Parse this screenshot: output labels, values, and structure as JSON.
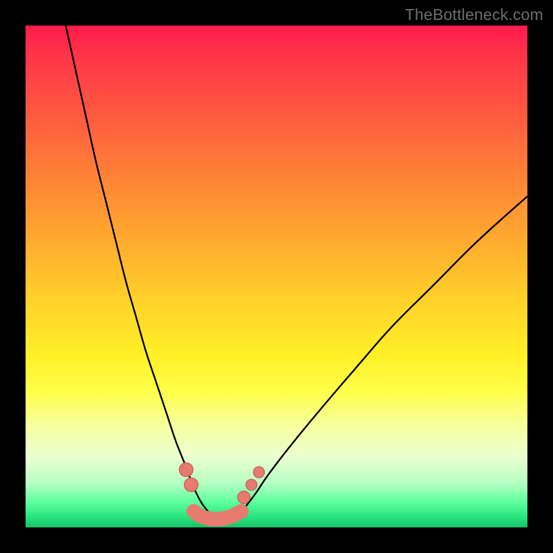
{
  "watermark": "TheBottleneck.com",
  "colors": {
    "background": "#000000",
    "gradient_top": "#ff1a4d",
    "gradient_bottom": "#19bf67",
    "curve": "#000000",
    "marker_fill": "#e77b70",
    "marker_stroke": "#c55a4f"
  },
  "chart_data": {
    "type": "line",
    "title": "",
    "xlabel": "",
    "ylabel": "",
    "xlim": [
      0,
      100
    ],
    "ylim": [
      0,
      100
    ],
    "grid": false,
    "legend": false,
    "series": [
      {
        "name": "left-curve",
        "x": [
          8,
          10,
          12,
          14,
          16,
          18,
          20,
          22,
          24,
          26,
          28,
          30,
          32,
          33.5,
          35,
          36.5
        ],
        "y": [
          100,
          91,
          82,
          73,
          65,
          57,
          49,
          42,
          35,
          29,
          23,
          17,
          12,
          8,
          5,
          3
        ]
      },
      {
        "name": "right-curve",
        "x": [
          43,
          44.5,
          46,
          48,
          51,
          55,
          60,
          66,
          73,
          81,
          90,
          100
        ],
        "y": [
          3,
          5,
          7,
          10,
          14,
          19,
          25,
          32,
          40,
          48,
          57,
          66
        ]
      },
      {
        "name": "trough-worm",
        "x": [
          33.5,
          35,
          37,
          39,
          41,
          43
        ],
        "y": [
          3.2,
          2.2,
          1.7,
          1.7,
          2.2,
          3.2
        ]
      }
    ],
    "markers": [
      {
        "name": "left-upper-dot",
        "x": 32.0,
        "y": 11.5,
        "r": 10
      },
      {
        "name": "left-lower-dot",
        "x": 33.0,
        "y": 8.5,
        "r": 10
      },
      {
        "name": "right-lower-dot",
        "x": 43.5,
        "y": 6.0,
        "r": 9
      },
      {
        "name": "right-mid-dot",
        "x": 45.0,
        "y": 8.5,
        "r": 8
      },
      {
        "name": "right-upper-dot",
        "x": 46.5,
        "y": 11.0,
        "r": 8
      }
    ]
  }
}
